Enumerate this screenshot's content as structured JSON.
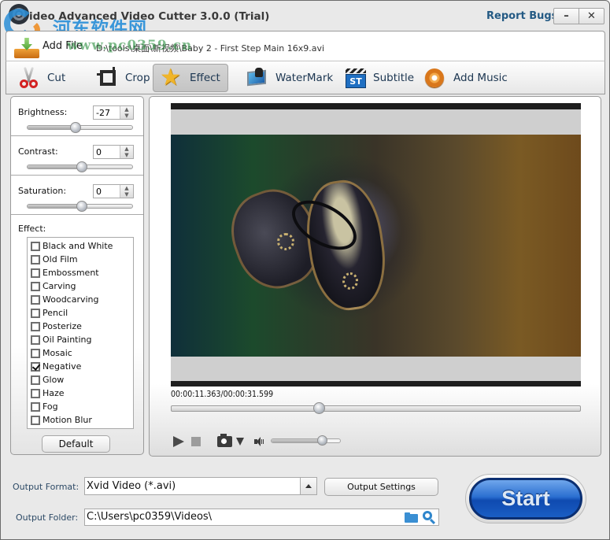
{
  "titlebar": {
    "title": "ideo Advanced Video Cutter 3.0.0 (Trial)",
    "watermark_text": "河东软件网",
    "watermark_url": "www.pc0359.cn",
    "report_bugs": "Report Bugs",
    "minimize_label": "–",
    "close_label": "✕"
  },
  "filebar": {
    "add_file_label": "Add File",
    "file_path": "D:\\tools\\桌面\\新视频\\Baby 2 - First Step Main 16x9.avi"
  },
  "toolbar": {
    "active": "Effect",
    "tools": [
      {
        "label": "Cut",
        "icon": "scissors-icon"
      },
      {
        "label": "Crop",
        "icon": "crop-icon"
      },
      {
        "label": "Effect",
        "icon": "star-icon"
      },
      {
        "label": "WaterMark",
        "icon": "watermark-icon"
      },
      {
        "label": "Subtitle",
        "icon": "subtitle-icon"
      },
      {
        "label": "Add Music",
        "icon": "music-disc-icon"
      }
    ],
    "subtitle_icon_text": "ST"
  },
  "adjustments": {
    "brightness": {
      "label": "Brightness:",
      "value": "-27",
      "slider_fraction": 0.46
    },
    "contrast": {
      "label": "Contrast:",
      "value": "0",
      "slider_fraction": 0.52
    },
    "saturation": {
      "label": "Saturation:",
      "value": "0",
      "slider_fraction": 0.52
    }
  },
  "effects": {
    "label": "Effect:",
    "items": [
      {
        "label": "Black and White",
        "checked": false
      },
      {
        "label": "Old Film",
        "checked": false
      },
      {
        "label": "Embossment",
        "checked": false
      },
      {
        "label": "Carving",
        "checked": false
      },
      {
        "label": "Woodcarving",
        "checked": false
      },
      {
        "label": "Pencil",
        "checked": false
      },
      {
        "label": "Posterize",
        "checked": false
      },
      {
        "label": "Oil Painting",
        "checked": false
      },
      {
        "label": "Mosaic",
        "checked": false
      },
      {
        "label": "Negative",
        "checked": true
      },
      {
        "label": "Glow",
        "checked": false
      },
      {
        "label": "Haze",
        "checked": false
      },
      {
        "label": "Fog",
        "checked": false
      },
      {
        "label": "Motion Blur",
        "checked": false
      }
    ],
    "default_button": "Default"
  },
  "player": {
    "current_time": "00:00:11.363",
    "total_time": "00:00:31.599",
    "separator": "/",
    "seek_fraction": 0.36,
    "volume_fraction": 0.73
  },
  "output": {
    "format_label": "Output Format:",
    "format_value": "Xvid Video (*.avi)",
    "settings_button": "Output Settings",
    "folder_label": "Output Folder:",
    "folder_value": "C:\\Users\\pc0359\\Videos\\",
    "start_button": "Start"
  },
  "colors": {
    "link_blue": "#245a84",
    "label_blue": "#2d4a66",
    "start_blue": "#2b6fd0",
    "watermark_blue": "#2b8fd8"
  }
}
